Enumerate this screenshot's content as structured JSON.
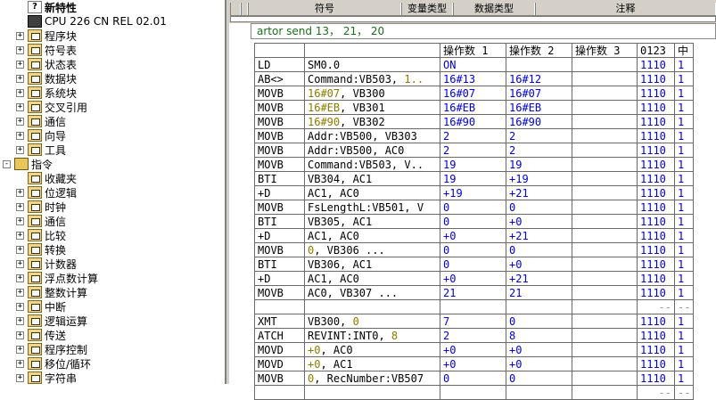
{
  "tree": {
    "items": [
      {
        "id": "new",
        "label": "新特性",
        "icon": "help-icon",
        "bold": true,
        "indent": 1,
        "expander": ""
      },
      {
        "id": "cpu",
        "label": "CPU 226 CN REL 02.01",
        "icon": "cpu-icon",
        "bold": false,
        "indent": 1,
        "expander": ""
      },
      {
        "id": "program",
        "label": "程序块",
        "icon": "folder-icon",
        "bold": false,
        "indent": 1,
        "expander": "+"
      },
      {
        "id": "symbol",
        "label": "符号表",
        "icon": "folder-icon",
        "bold": false,
        "indent": 1,
        "expander": "+"
      },
      {
        "id": "status",
        "label": "状态表",
        "icon": "folder-icon",
        "bold": false,
        "indent": 1,
        "expander": "+"
      },
      {
        "id": "datablock",
        "label": "数据块",
        "icon": "folder-icon",
        "bold": false,
        "indent": 1,
        "expander": "+"
      },
      {
        "id": "sysblock",
        "label": "系统块",
        "icon": "folder-icon",
        "bold": false,
        "indent": 1,
        "expander": "+"
      },
      {
        "id": "xref",
        "label": "交叉引用",
        "icon": "folder-icon",
        "bold": false,
        "indent": 1,
        "expander": "+"
      },
      {
        "id": "comm",
        "label": "通信",
        "icon": "folder-icon",
        "bold": false,
        "indent": 1,
        "expander": "+"
      },
      {
        "id": "wizard",
        "label": "向导",
        "icon": "folder-icon",
        "bold": false,
        "indent": 1,
        "expander": "+"
      },
      {
        "id": "tools",
        "label": "工具",
        "icon": "folder-icon",
        "bold": false,
        "indent": 1,
        "expander": "+"
      },
      {
        "id": "instructions",
        "label": "指令",
        "icon": "book-icon",
        "bold": false,
        "indent": 0,
        "expander": "-"
      },
      {
        "id": "fav",
        "label": "收藏夹",
        "icon": "folder-icon",
        "bold": false,
        "indent": 1,
        "expander": ""
      },
      {
        "id": "bitlogic",
        "label": "位逻辑",
        "icon": "folder-icon",
        "bold": false,
        "indent": 1,
        "expander": "+"
      },
      {
        "id": "clock",
        "label": "时钟",
        "icon": "folder-icon",
        "bold": false,
        "indent": 1,
        "expander": "+"
      },
      {
        "id": "comm2",
        "label": "通信",
        "icon": "folder-icon",
        "bold": false,
        "indent": 1,
        "expander": "+"
      },
      {
        "id": "compare",
        "label": "比较",
        "icon": "folder-icon",
        "bold": false,
        "indent": 1,
        "expander": "+"
      },
      {
        "id": "convert",
        "label": "转换",
        "icon": "folder-icon",
        "bold": false,
        "indent": 1,
        "expander": "+"
      },
      {
        "id": "counter",
        "label": "计数器",
        "icon": "folder-icon",
        "bold": false,
        "indent": 1,
        "expander": "+"
      },
      {
        "id": "float",
        "label": "浮点数计算",
        "icon": "folder-icon",
        "bold": false,
        "indent": 1,
        "expander": "+"
      },
      {
        "id": "integer",
        "label": "整数计算",
        "icon": "folder-icon",
        "bold": false,
        "indent": 1,
        "expander": "+"
      },
      {
        "id": "interrupt",
        "label": "中断",
        "icon": "folder-icon",
        "bold": false,
        "indent": 1,
        "expander": "+"
      },
      {
        "id": "logic",
        "label": "逻辑运算",
        "icon": "folder-icon",
        "bold": false,
        "indent": 1,
        "expander": "+"
      },
      {
        "id": "move",
        "label": "传送",
        "icon": "folder-icon",
        "bold": false,
        "indent": 1,
        "expander": "+"
      },
      {
        "id": "progctrl",
        "label": "程序控制",
        "icon": "folder-icon",
        "bold": false,
        "indent": 1,
        "expander": "+"
      },
      {
        "id": "shift",
        "label": "移位/循环",
        "icon": "folder-icon",
        "bold": false,
        "indent": 1,
        "expander": "+"
      },
      {
        "id": "string",
        "label": "字符串",
        "icon": "folder-icon",
        "bold": false,
        "indent": 1,
        "expander": "+"
      }
    ]
  },
  "symbol_header": {
    "cols": [
      "符号",
      "变量类型",
      "数据类型",
      "注释"
    ]
  },
  "status_window": {
    "title": "artor send 13， 21， 20",
    "headers": [
      "",
      "",
      "操作数 1",
      "操作数 2",
      "操作数 3",
      "0123",
      "中"
    ],
    "rows": [
      {
        "instr": "LD",
        "operand": [
          {
            "t": "SM0.0",
            "c": "plain"
          }
        ],
        "o1": "ON",
        "o2": "",
        "o3": "",
        "bits": "1110",
        "m": "1"
      },
      {
        "instr": "AB<>",
        "operand": [
          {
            "t": "Command:VB503, ",
            "c": "plain"
          },
          {
            "t": "1..",
            "c": "const"
          }
        ],
        "o1": "16#13",
        "o2": "16#12",
        "o3": "",
        "bits": "1110",
        "m": "1"
      },
      {
        "instr": "MOVB",
        "operand": [
          {
            "t": "16#07",
            "c": "const"
          },
          {
            "t": ", VB300",
            "c": "plain"
          }
        ],
        "o1": "16#07",
        "o2": "16#07",
        "o3": "",
        "bits": "1110",
        "m": "1"
      },
      {
        "instr": "MOVB",
        "operand": [
          {
            "t": "16#EB",
            "c": "const"
          },
          {
            "t": ", VB301",
            "c": "plain"
          }
        ],
        "o1": "16#EB",
        "o2": "16#EB",
        "o3": "",
        "bits": "1110",
        "m": "1"
      },
      {
        "instr": "MOVB",
        "operand": [
          {
            "t": "16#90",
            "c": "const"
          },
          {
            "t": ", VB302",
            "c": "plain"
          }
        ],
        "o1": "16#90",
        "o2": "16#90",
        "o3": "",
        "bits": "1110",
        "m": "1"
      },
      {
        "instr": "MOVB",
        "operand": [
          {
            "t": "Addr:VB500, VB303",
            "c": "plain"
          }
        ],
        "o1": "2",
        "o2": "2",
        "o3": "",
        "bits": "1110",
        "m": "1"
      },
      {
        "instr": "MOVB",
        "operand": [
          {
            "t": "Addr:VB500, AC0",
            "c": "plain"
          }
        ],
        "o1": "2",
        "o2": "2",
        "o3": "",
        "bits": "1110",
        "m": "1"
      },
      {
        "instr": "MOVB",
        "operand": [
          {
            "t": "Command:VB503, V..",
            "c": "plain"
          }
        ],
        "o1": "19",
        "o2": "19",
        "o3": "",
        "bits": "1110",
        "m": "1"
      },
      {
        "instr": "BTI",
        "operand": [
          {
            "t": "VB304, AC1",
            "c": "plain"
          }
        ],
        "o1": "19",
        "o2": "+19",
        "o3": "",
        "bits": "1110",
        "m": "1"
      },
      {
        "instr": "+D",
        "operand": [
          {
            "t": "AC1, AC0",
            "c": "plain"
          }
        ],
        "o1": "+19",
        "o2": "+21",
        "o3": "",
        "bits": "1110",
        "m": "1"
      },
      {
        "instr": "MOVB",
        "operand": [
          {
            "t": "FsLengthL:VB501, V",
            "c": "plain"
          }
        ],
        "o1": "0",
        "o2": "0",
        "o3": "",
        "bits": "1110",
        "m": "1"
      },
      {
        "instr": "BTI",
        "operand": [
          {
            "t": "VB305, AC1",
            "c": "plain"
          }
        ],
        "o1": "0",
        "o2": "+0",
        "o3": "",
        "bits": "1110",
        "m": "1"
      },
      {
        "instr": "+D",
        "operand": [
          {
            "t": "AC1, AC0",
            "c": "plain"
          }
        ],
        "o1": "+0",
        "o2": "+21",
        "o3": "",
        "bits": "1110",
        "m": "1"
      },
      {
        "instr": "MOVB",
        "operand": [
          {
            "t": "0",
            "c": "const"
          },
          {
            "t": ", VB306        ...",
            "c": "plain"
          }
        ],
        "o1": "0",
        "o2": "0",
        "o3": "",
        "bits": "1110",
        "m": "1"
      },
      {
        "instr": "BTI",
        "operand": [
          {
            "t": "VB306, AC1",
            "c": "plain"
          }
        ],
        "o1": "0",
        "o2": "+0",
        "o3": "",
        "bits": "1110",
        "m": "1"
      },
      {
        "instr": "+D",
        "operand": [
          {
            "t": "AC1, AC0",
            "c": "plain"
          }
        ],
        "o1": "+0",
        "o2": "+21",
        "o3": "",
        "bits": "1110",
        "m": "1"
      },
      {
        "instr": "MOVB",
        "operand": [
          {
            "t": "AC0, VB307       ...",
            "c": "plain"
          }
        ],
        "o1": "21",
        "o2": "21",
        "o3": "",
        "bits": "1110",
        "m": "1"
      },
      {
        "instr": "",
        "operand": [],
        "o1": "",
        "o2": "",
        "o3": "",
        "bits": "--",
        "m": "--",
        "blank": true
      },
      {
        "instr": "XMT",
        "operand": [
          {
            "t": "VB300, ",
            "c": "plain"
          },
          {
            "t": "0",
            "c": "const"
          }
        ],
        "o1": "7",
        "o2": "0",
        "o3": "",
        "bits": "1110",
        "m": "1"
      },
      {
        "instr": "ATCH",
        "operand": [
          {
            "t": "REVINT:INT0, ",
            "c": "plain"
          },
          {
            "t": "8",
            "c": "const"
          }
        ],
        "o1": "2",
        "o2": "8",
        "o3": "",
        "bits": "1110",
        "m": "1"
      },
      {
        "instr": "MOVD",
        "operand": [
          {
            "t": "+0",
            "c": "const"
          },
          {
            "t": ", AC0",
            "c": "plain"
          }
        ],
        "o1": "+0",
        "o2": "+0",
        "o3": "",
        "bits": "1110",
        "m": "1"
      },
      {
        "instr": "MOVD",
        "operand": [
          {
            "t": "+0",
            "c": "const"
          },
          {
            "t": ", AC1",
            "c": "plain"
          }
        ],
        "o1": "+0",
        "o2": "+0",
        "o3": "",
        "bits": "1110",
        "m": "1"
      },
      {
        "instr": "MOVB",
        "operand": [
          {
            "t": "0",
            "c": "const"
          },
          {
            "t": ", RecNumber:VB507",
            "c": "plain"
          }
        ],
        "o1": "0",
        "o2": "0",
        "o3": "",
        "bits": "1110",
        "m": "1"
      },
      {
        "instr": "",
        "operand": [],
        "o1": "",
        "o2": "",
        "o3": "",
        "bits": "--",
        "m": "--",
        "blank": true
      }
    ]
  }
}
